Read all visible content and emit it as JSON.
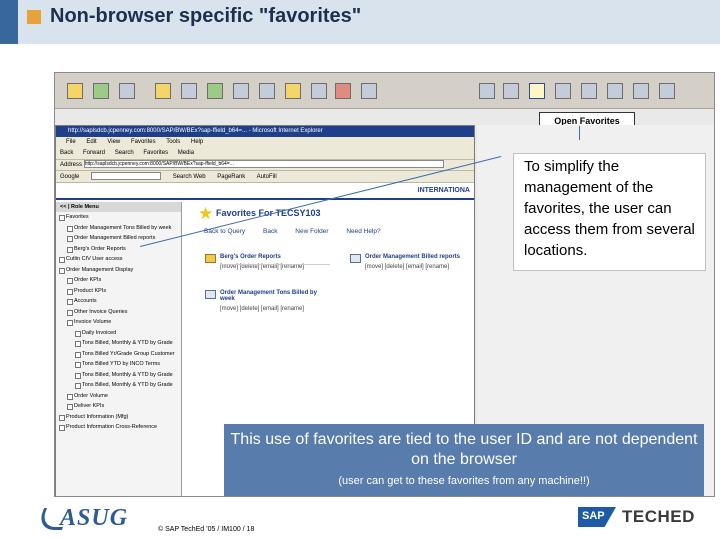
{
  "slide": {
    "title": "Non-browser specific \"favorites\"",
    "note": "To simplify the management of the favorites, the user can access them from several locations.",
    "banner_main": "This use of favorites are tied to the user ID and are not dependent on the browser",
    "banner_sub": "(user can get to these favorites from any machine!!)",
    "copyright": "© SAP TechEd ’05 / IM100 / 18",
    "asug_logo": "ASUG",
    "sap_logo": "SAP",
    "teched_logo": "TECHED",
    "colors": {
      "header_blue": "#37679c",
      "accent_orange": "#e8a23a",
      "banner_blue": "#587cab"
    }
  },
  "app_toolbar": {
    "open_favorites_label": "Open Favorites",
    "icons": [
      "home-icon",
      "calculator-icon",
      "tree-icon",
      "star-icon",
      "layout-icon",
      "table-icon",
      "chart-icon",
      "filter-icon",
      "grid-icon",
      "document-icon",
      "print-icon",
      "settings-icon",
      "export-icon",
      "save-icon",
      "save-as-icon",
      "open-favorites-icon",
      "info-icon",
      "mail-icon",
      "refresh-icon",
      "close-icon"
    ]
  },
  "browser": {
    "title": "http://saplsdcb.jcpenney.com:8000/SAP/BW/BEx?sap-ffield_b64=...  - Microsoft Internet Explorer",
    "menu": [
      "File",
      "Edit",
      "View",
      "Favorites",
      "Tools",
      "Help"
    ],
    "toolbar": [
      "Back",
      "Forward",
      "Search",
      "Favorites",
      "Media"
    ],
    "address_label": "Address",
    "address_value": "http://saplsdcb.jcpenney.com:8000/SAP/BW/BEx?sap-ffield_b64=...",
    "google_label": "Google",
    "google_actions": [
      "Search Web",
      "PageRank",
      "AutoFill"
    ],
    "brand": "INTERNATIONA"
  },
  "role_menu": {
    "title": "<< | Role Menu",
    "items": [
      {
        "label": "Favorites",
        "level": 0
      },
      {
        "label": "Order Management Tons Billed by week",
        "level": 1
      },
      {
        "label": "Order Management Billed reports",
        "level": 1
      },
      {
        "label": "Berg's Order Reports",
        "level": 1
      },
      {
        "label": "Cutlin CIV User access",
        "level": 0
      },
      {
        "label": "Order Management Display",
        "level": 0
      },
      {
        "label": "Order KPIs",
        "level": 1
      },
      {
        "label": "Product KPIs",
        "level": 1
      },
      {
        "label": "Accounts",
        "level": 1
      },
      {
        "label": "Other Invoice Queries",
        "level": 1
      },
      {
        "label": "Invoice Volume",
        "level": 1
      },
      {
        "label": "Daily Invoiced",
        "level": 2
      },
      {
        "label": "Tons Billed, Monthly & YTD by Grade",
        "level": 2
      },
      {
        "label": "Tons Billed Yr/Grade Group Customer",
        "level": 2
      },
      {
        "label": "Tons Billed YTD by INCO Terms",
        "level": 2
      },
      {
        "label": "Tons Billed, Monthly & YTD by Grade",
        "level": 2
      },
      {
        "label": "Tons Billed, Monthly & YTD by Grade",
        "level": 2
      },
      {
        "label": "Order Volume",
        "level": 1
      },
      {
        "label": "Deliver KPIs",
        "level": 1
      },
      {
        "label": "Product Information (Mfg)",
        "level": 0
      },
      {
        "label": "Product Information Cross-Reference",
        "level": 0
      }
    ]
  },
  "favorites": {
    "title": "Favorites For TECSY103",
    "links": [
      "Back to Query",
      "Back",
      "New Folder",
      "Need Help?"
    ],
    "items": [
      {
        "name": "Berg's Order Reports",
        "actions": "[move] [delete] [email] [rename]"
      },
      {
        "name": "Order Management Billed reports",
        "actions": "[move] [delete] [email] [rename]"
      },
      {
        "name": "Order Management Tons Billed by week",
        "actions": "[move] [delete] [email] [rename]"
      }
    ]
  }
}
